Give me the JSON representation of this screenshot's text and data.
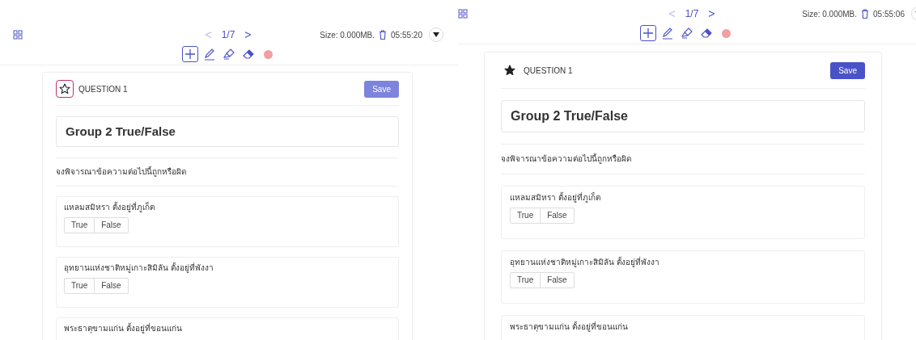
{
  "panels": [
    {
      "topbar": {
        "prev": "<",
        "page": "1/7",
        "next": ">",
        "size": "Size: 0.000MB.",
        "time": "05:55:20"
      },
      "tools": [
        {
          "kind": "move",
          "selected": true
        },
        {
          "kind": "pen",
          "selected": false
        },
        {
          "kind": "highlighter",
          "selected": false
        },
        {
          "kind": "eraser",
          "selected": false
        },
        {
          "kind": "color",
          "selected": false
        }
      ],
      "card": {
        "starred": false,
        "star_focused": true,
        "question_label": "QUESTION 1",
        "save": {
          "label": "Save",
          "disabled": true
        },
        "title": "Group 2 True/False",
        "instruction": "จงพิจารณาข้อความต่อไปนี้ถูกหรือผิด",
        "questions": [
          {
            "text": "แหลมสมิหรา ตั้งอยู่ที่ภูเก็ต",
            "options": [
              "True",
              "False"
            ]
          },
          {
            "text": "อุทยานแห่งชาติหมู่เกาะสิมิลัน ตั้งอยู่ที่พังงา",
            "options": [
              "True",
              "False"
            ]
          },
          {
            "text": "พระธาตุขามแก่น ตั้งอยู่ที่ขอนแก่น"
          }
        ]
      }
    },
    {
      "topbar": {
        "prev": "<",
        "page": "1/7",
        "next": ">",
        "size": "Size: 0.000MB.",
        "time": "05:55:06"
      },
      "tools": [
        {
          "kind": "move",
          "selected": true
        },
        {
          "kind": "pen",
          "selected": false
        },
        {
          "kind": "highlighter",
          "selected": false
        },
        {
          "kind": "eraser",
          "selected": false
        },
        {
          "kind": "color",
          "selected": false
        }
      ],
      "card": {
        "starred": true,
        "star_focused": false,
        "question_label": "QUESTION 1",
        "save": {
          "label": "Save",
          "disabled": false
        },
        "title": "Group 2 True/False",
        "instruction": "จงพิจารณาข้อความต่อไปนี้ถูกหรือผิด",
        "questions": [
          {
            "text": "แหลมสมิหรา ตั้งอยู่ที่ภูเก็ต",
            "options": [
              "True",
              "False"
            ]
          },
          {
            "text": "อุทยานแห่งชาติหมู่เกาะสิมิลัน ตั้งอยู่ที่พังงา",
            "options": [
              "True",
              "False"
            ]
          },
          {
            "text": "พระธาตุขามแก่น ตั้งอยู่ที่ขอนแก่น"
          }
        ]
      }
    }
  ]
}
